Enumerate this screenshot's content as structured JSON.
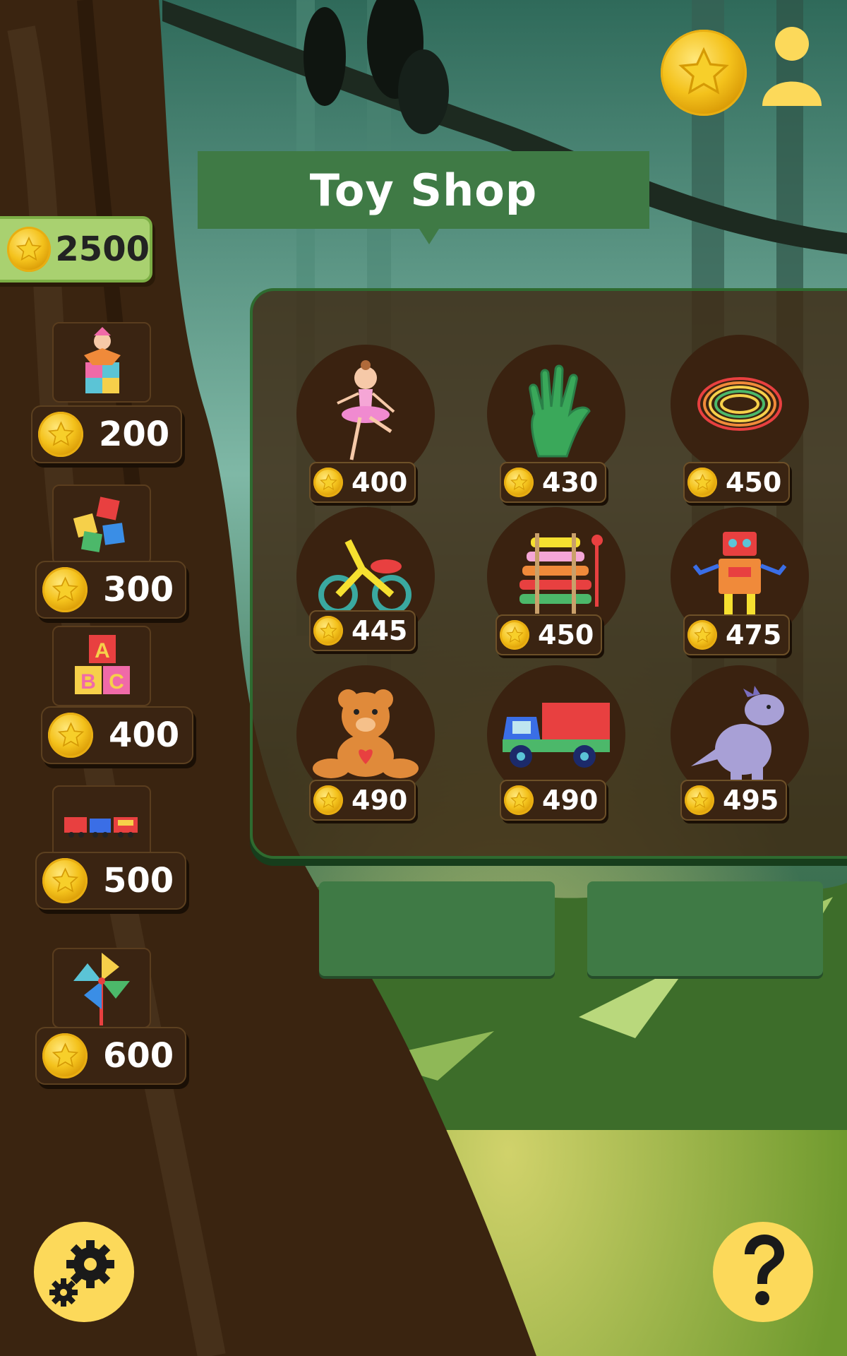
{
  "shop": {
    "title": "Toy Shop"
  },
  "balance": {
    "amount": "2500"
  },
  "side_items": [
    {
      "name": "jack-in-the-box",
      "price": "200"
    },
    {
      "name": "jigsaw-puzzle",
      "price": "300"
    },
    {
      "name": "abc-blocks",
      "price": "400"
    },
    {
      "name": "toy-train",
      "price": "500"
    },
    {
      "name": "pinwheel",
      "price": "600"
    }
  ],
  "toys": [
    {
      "name": "ballerina",
      "price": "400"
    },
    {
      "name": "slime-hand",
      "price": "430"
    },
    {
      "name": "rainbow-spring",
      "price": "450"
    },
    {
      "name": "tricycle",
      "price": "445"
    },
    {
      "name": "xylophone",
      "price": "450"
    },
    {
      "name": "robot",
      "price": "475"
    },
    {
      "name": "teddy-bear",
      "price": "490"
    },
    {
      "name": "toy-truck",
      "price": "490"
    },
    {
      "name": "dinosaur",
      "price": "495"
    }
  ],
  "icons": {
    "top_coin": "star-coin-icon",
    "profile": "user-profile-icon",
    "settings": "gear-icon",
    "help": "question-mark-icon"
  },
  "colors": {
    "banner_green": "#3f7a45",
    "coin_gold": "#f4c21c",
    "button_yellow": "#fcd95a",
    "balance_green": "#a9d170"
  }
}
